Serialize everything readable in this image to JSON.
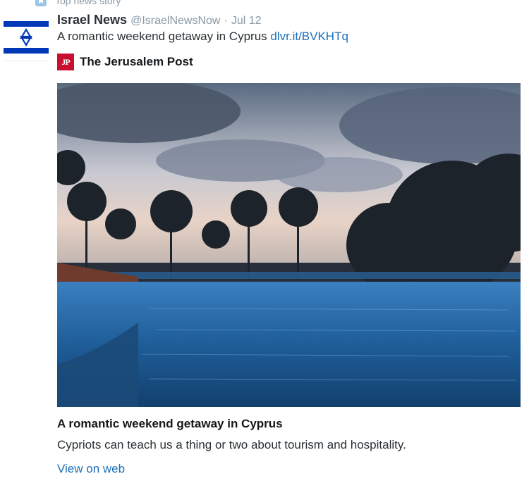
{
  "context": {
    "label": "Top news story",
    "icon": "news-badge-icon"
  },
  "tweet": {
    "author_name": "Israel News",
    "handle": "@IsraelNewsNow",
    "separator": "·",
    "date": "Jul 12",
    "text": "A romantic weekend getaway in Cyprus",
    "link_text": "dlvr.it/BVKHTq"
  },
  "source": {
    "logo_text": "JP",
    "name": "The Jerusalem Post"
  },
  "card": {
    "title": "A romantic weekend getaway in Cyprus",
    "description": "Cypriots can teach us a thing or two about tourism and hospitality.",
    "view_label": "View on web"
  },
  "colors": {
    "link": "#1b6fb5",
    "muted": "#8899a6",
    "flag_blue": "#0038b8",
    "jp_red": "#c8102e"
  }
}
